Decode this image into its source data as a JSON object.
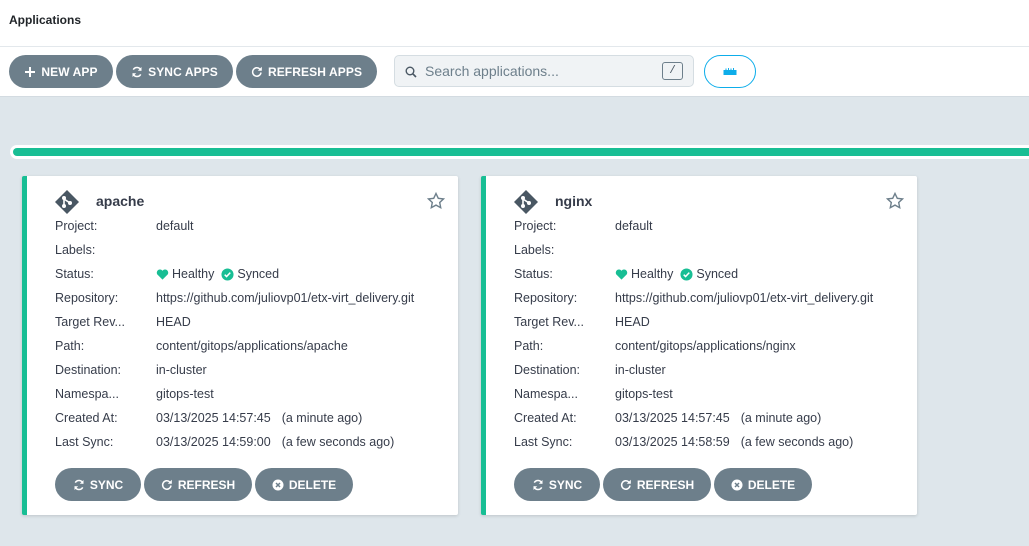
{
  "header": {
    "title": "Applications"
  },
  "toolbar": {
    "new_app": "NEW APP",
    "sync_apps": "SYNC APPS",
    "refresh_apps": "REFRESH APPS",
    "search_placeholder": "Search applications...",
    "search_shortcut": "/"
  },
  "progress": {
    "fraction": 1.0,
    "color": "#18be94"
  },
  "labels": {
    "project": "Project:",
    "labels": "Labels:",
    "status": "Status:",
    "repository": "Repository:",
    "target_revision": "Target Rev...",
    "path": "Path:",
    "destination": "Destination:",
    "namespace": "Namespa...",
    "created_at": "Created At:",
    "last_sync": "Last Sync:"
  },
  "buttons": {
    "sync": "SYNC",
    "refresh": "REFRESH",
    "delete": "DELETE"
  },
  "apps": [
    {
      "name": "apache",
      "project": "default",
      "labels": "",
      "health": "Healthy",
      "sync": "Synced",
      "repository": "https://github.com/juliovp01/etx-virt_delivery.git",
      "target_revision": "HEAD",
      "path": "content/gitops/applications/apache",
      "destination": "in-cluster",
      "namespace": "gitops-test",
      "created_at": "03/13/2025 14:57:45",
      "created_ago": "(a minute ago)",
      "last_sync": "03/13/2025 14:59:00",
      "last_sync_ago": "(a few seconds ago)"
    },
    {
      "name": "nginx",
      "project": "default",
      "labels": "",
      "health": "Healthy",
      "sync": "Synced",
      "repository": "https://github.com/juliovp01/etx-virt_delivery.git",
      "target_revision": "HEAD",
      "path": "content/gitops/applications/nginx",
      "destination": "in-cluster",
      "namespace": "gitops-test",
      "created_at": "03/13/2025 14:57:45",
      "created_ago": "(a minute ago)",
      "last_sync": "03/13/2025 14:58:59",
      "last_sync_ago": "(a few seconds ago)"
    }
  ],
  "colors": {
    "healthy": "#18be94",
    "synced": "#18be94",
    "button": "#6d7f8b",
    "accent": "#0dadea"
  },
  "icons": {
    "plus": "plus-icon",
    "sync": "sync-icon",
    "refresh": "refresh-icon",
    "search": "search-icon",
    "view": "ruler-icon",
    "app": "git-icon",
    "favorite": "star-icon",
    "health": "heart-icon",
    "synced": "check-circle-icon",
    "delete": "times-circle-icon"
  }
}
